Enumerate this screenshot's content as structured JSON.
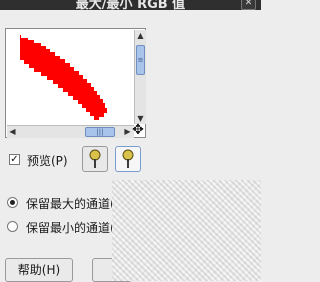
{
  "window": {
    "title": "最大/最小 RGB 值",
    "close_icon": "close-icon"
  },
  "preview": {
    "fill_color": "#ff0000",
    "checkbox_checked": true,
    "label": "预览(P)"
  },
  "pickers": [
    {
      "icon": "eyedropper-icon",
      "active": false
    },
    {
      "icon": "eyedropper-icon",
      "active": true
    }
  ],
  "options": [
    {
      "label": "保留最大的通道(H)",
      "selected": true
    },
    {
      "label": "保留最小的通道(I)",
      "selected": false
    }
  ],
  "buttons": {
    "help": "帮助(H)"
  }
}
